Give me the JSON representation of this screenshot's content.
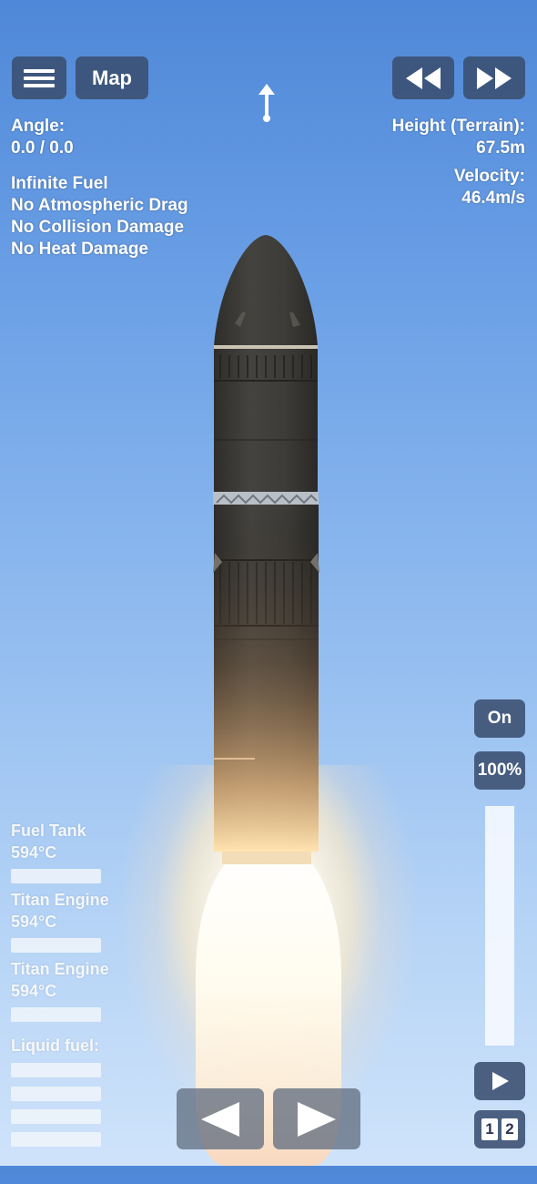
{
  "top_bar": {
    "map_label": "Map"
  },
  "telemetry": {
    "angle_label": "Angle:",
    "angle_value": "0.0 / 0.0",
    "height_label": "Height (Terrain):",
    "height_value": "67.5m",
    "velocity_label": "Velocity:",
    "velocity_value": "46.4m/s"
  },
  "cheats": [
    "Infinite Fuel",
    "No Atmospheric Drag",
    "No Collision Damage",
    "No Heat Damage"
  ],
  "parts": [
    {
      "name": "Fuel Tank",
      "temp": "594°C"
    },
    {
      "name": "Titan Engine",
      "temp": "594°C"
    },
    {
      "name": "Titan Engine",
      "temp": "594°C"
    }
  ],
  "resources": {
    "label": "Liquid fuel:"
  },
  "throttle": {
    "on_label": "On",
    "percent_label": "100%",
    "level": 1.0
  },
  "controls": {
    "play_icon": "play-icon",
    "left_icon": "arrow-left-icon",
    "right_icon": "arrow-right-icon",
    "stage_1": "1",
    "stage_2": "2"
  },
  "colors": {
    "button_bg": "#3a4e70",
    "hull": "#3b3a36"
  }
}
